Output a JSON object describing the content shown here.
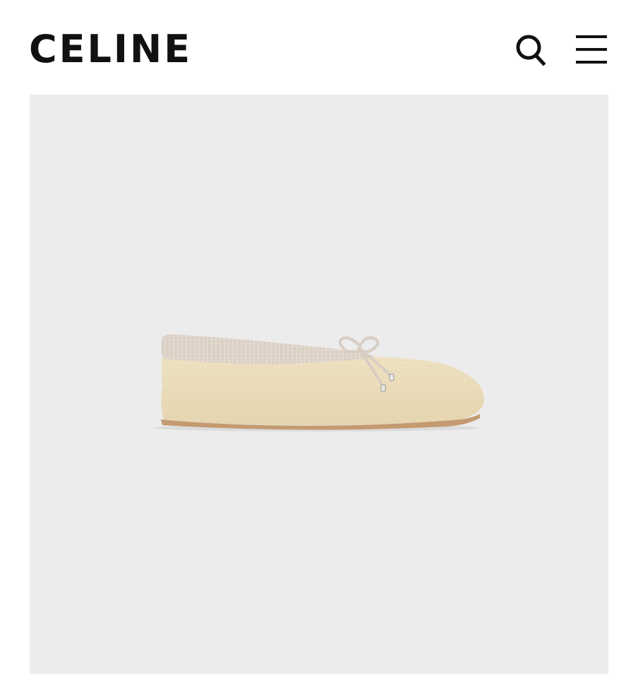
{
  "header": {
    "logo_text": "CELINE",
    "search_icon": "search-icon",
    "menu_icon": "hamburger-menu-icon"
  },
  "product": {
    "image_icon": "ballet-flat-shoe-image"
  },
  "colors": {
    "background": "#ffffff",
    "image_background": "#ececec",
    "logo": "#111111",
    "shoe_body": "#ece0c2",
    "shoe_collar": "#e2d7cd",
    "sole": "#c8a27a"
  }
}
